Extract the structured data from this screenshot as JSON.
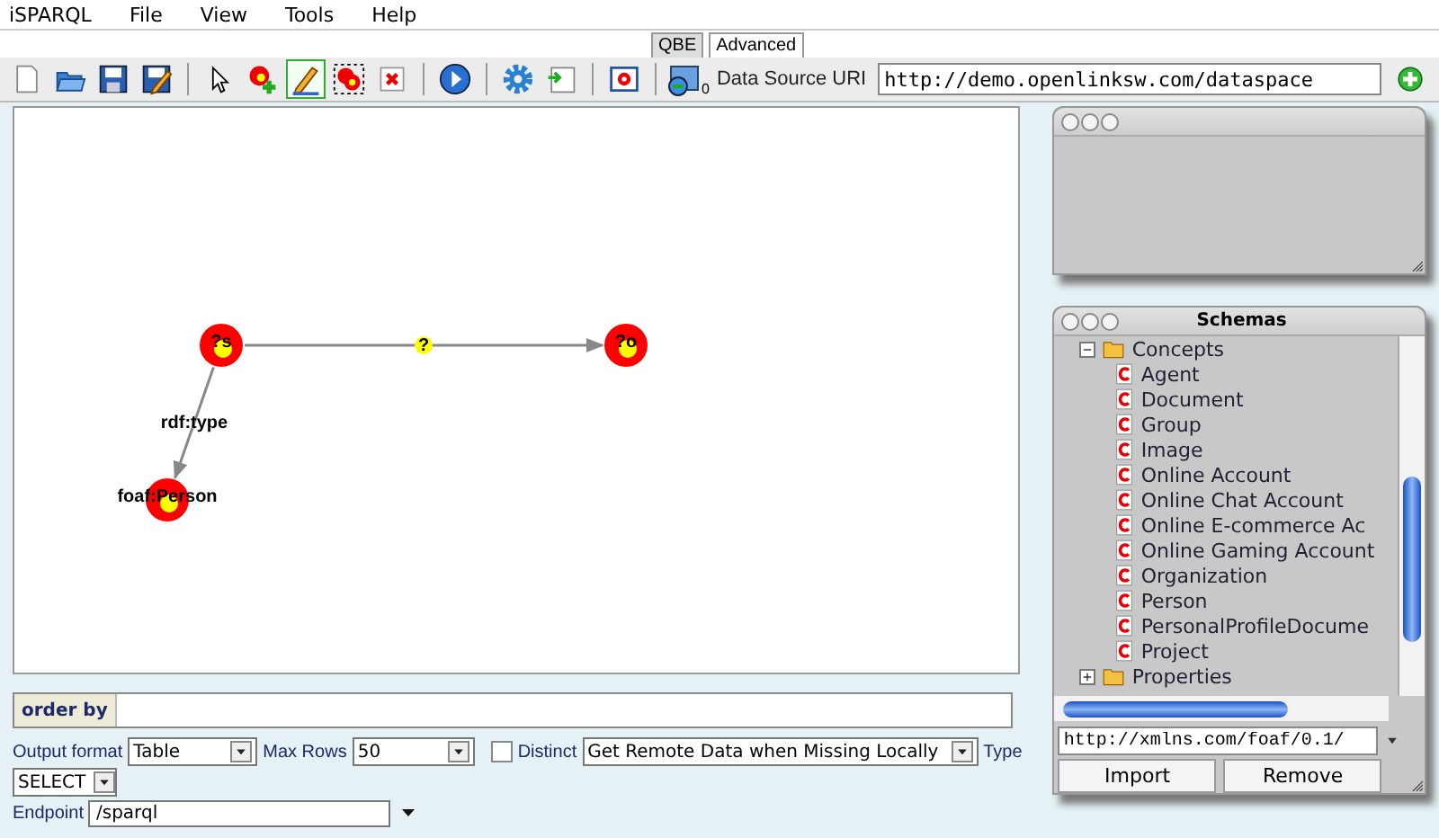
{
  "menu": [
    "iSPARQL",
    "File",
    "View",
    "Tools",
    "Help"
  ],
  "tabs": [
    {
      "label": "QBE",
      "selected": true
    },
    {
      "label": "Advanced",
      "selected": false
    }
  ],
  "toolbar": {
    "groups": [
      [
        {
          "kind": "new",
          "selected": false
        },
        {
          "kind": "open",
          "selected": false
        },
        {
          "kind": "save",
          "selected": false
        },
        {
          "kind": "save-as",
          "selected": false
        }
      ],
      [
        {
          "kind": "pointer",
          "selected": false
        },
        {
          "kind": "add-node",
          "selected": false
        },
        {
          "kind": "edit",
          "selected": true
        },
        {
          "kind": "group",
          "selected": false
        },
        {
          "kind": "delete",
          "selected": false
        }
      ],
      [
        {
          "kind": "run",
          "selected": false
        }
      ],
      [
        {
          "kind": "settings",
          "selected": false
        },
        {
          "kind": "import",
          "selected": false
        }
      ],
      [
        {
          "kind": "clear",
          "selected": false
        }
      ]
    ],
    "dataset_count": "0",
    "source_label": "Data Source URI",
    "source_value": "http://demo.openlinksw.com/dataspace"
  },
  "canvas": {
    "nodes": [
      {
        "label": "?s"
      },
      {
        "label": "?o"
      },
      {
        "label": "foaf:Person"
      }
    ],
    "edges": [
      {
        "label": "?",
        "variable": true
      },
      {
        "label": "rdf:type",
        "variable": false
      }
    ]
  },
  "order_by": {
    "label": "order by"
  },
  "options": {
    "output_format_label": "Output format",
    "output_format": "Table",
    "max_rows_label": "Max Rows",
    "max_rows": "50",
    "distinct_label": "Distinct",
    "distinct": false,
    "remote": "Get Remote Data when Missing Locally",
    "type_label": "Type",
    "type": "SELECT",
    "endpoint_label": "Endpoint",
    "endpoint": "/sparql"
  },
  "schemas": {
    "title": "Schemas",
    "tree": [
      {
        "label": "Concepts",
        "expanded": true,
        "children": [
          {
            "label": "Agent"
          },
          {
            "label": "Document"
          },
          {
            "label": "Group"
          },
          {
            "label": "Image"
          },
          {
            "label": "Online Account"
          },
          {
            "label": "Online Chat Account"
          },
          {
            "label": "Online E-commerce Ac"
          },
          {
            "label": "Online Gaming Account"
          },
          {
            "label": "Organization"
          },
          {
            "label": "Person"
          },
          {
            "label": "PersonalProfileDocume"
          },
          {
            "label": "Project"
          }
        ]
      },
      {
        "label": "Properties",
        "expanded": false
      }
    ],
    "url": "http://xmlns.com/foaf/0.1/",
    "buttons": [
      "Import",
      "Remove"
    ]
  }
}
